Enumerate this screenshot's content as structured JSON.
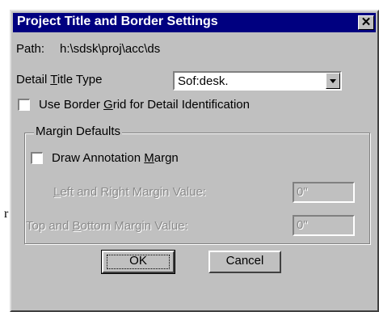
{
  "dialog": {
    "title": "Project Title and Border Settings",
    "close_glyph": "✕",
    "path_label": "Path:",
    "path_value": "h:\\sdsk\\proj\\acc\\ds",
    "detail_title_type_label": "Detail Title Type",
    "detail_title_type_value": "Sof:desk.",
    "use_border_grid_label": "Use Border Grid for Detail Identification",
    "use_border_grid_checked": false,
    "margin_group_title": "Margin Defaults",
    "draw_annotation_label": "Draw Annotation Margn",
    "draw_annotation_checked": false,
    "left_right_label": "Left and Right Margin Value:",
    "left_right_value": "0\"",
    "top_bottom_label": "Top and Bottom Margin Value:",
    "top_bottom_value": "0\"",
    "ok_label": "OK",
    "cancel_label": "Cancel"
  },
  "background": {
    "stray_letter": "r"
  },
  "colors": {
    "face": "#c0c0c0",
    "titlebar": "#000080",
    "disabled_text": "#8a8a8a"
  }
}
